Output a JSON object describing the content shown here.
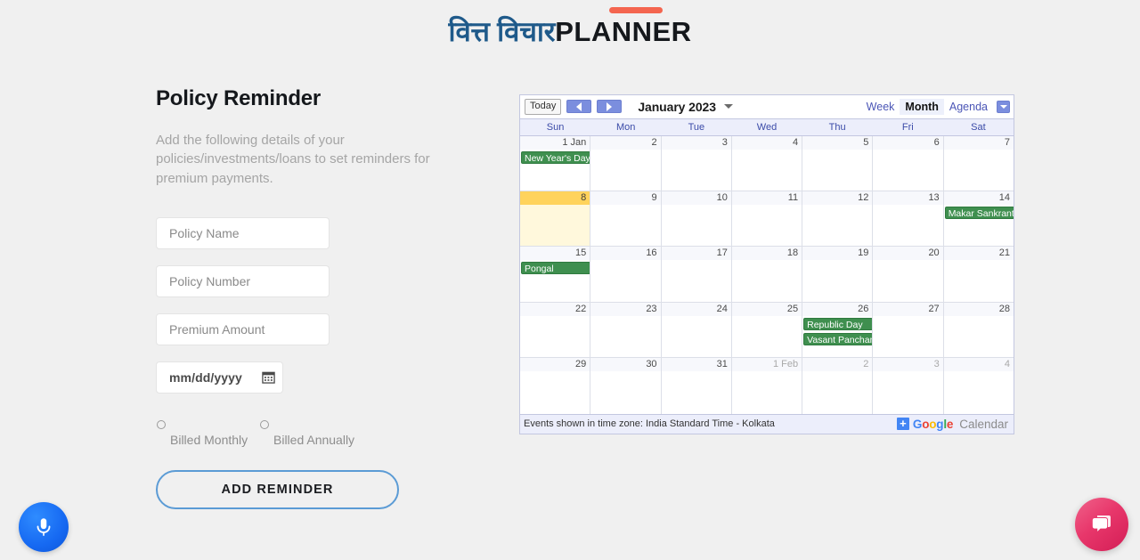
{
  "logo": {
    "hindi": "वित्त विचार",
    "english": "PLANNER",
    "bar_color": "#f4654f",
    "hindi_color": "#1f5a8a"
  },
  "form": {
    "title": "Policy Reminder",
    "description": "Add the following details of your policies/investments/loans to set reminders for premium payments.",
    "fields": [
      {
        "name": "policy-name",
        "placeholder": "Policy Name",
        "value": ""
      },
      {
        "name": "policy-number",
        "placeholder": "Policy Number",
        "value": ""
      },
      {
        "name": "premium-amount",
        "placeholder": "Premium Amount",
        "value": ""
      }
    ],
    "date": {
      "placeholder": "mm/dd/yyyy",
      "value": "mm/dd/yyyy",
      "icon": "calendar-icon"
    },
    "radios": [
      {
        "label": "Billed Monthly",
        "selected": false
      },
      {
        "label": "Billed Annually",
        "selected": false
      }
    ],
    "submit_label": "ADD REMINDER",
    "submit_border_color": "#5b9bd5"
  },
  "calendar": {
    "today_label": "Today",
    "prev_icon": "chevron-left-icon",
    "next_icon": "chevron-right-icon",
    "title": "January 2023",
    "title_caret_icon": "chevron-down-icon",
    "views": [
      {
        "label": "Week",
        "active": false
      },
      {
        "label": "Month",
        "active": true
      },
      {
        "label": "Agenda",
        "active": false
      }
    ],
    "view_caret_icon": "chevron-down-icon",
    "day_headers": [
      "Sun",
      "Mon",
      "Tue",
      "Wed",
      "Thu",
      "Fri",
      "Sat"
    ],
    "weeks": [
      [
        {
          "num": "1 Jan",
          "other": false,
          "today": false,
          "events": [
            {
              "title": "New Year's Day"
            }
          ]
        },
        {
          "num": "2",
          "other": false,
          "today": false,
          "events": []
        },
        {
          "num": "3",
          "other": false,
          "today": false,
          "events": []
        },
        {
          "num": "4",
          "other": false,
          "today": false,
          "events": []
        },
        {
          "num": "5",
          "other": false,
          "today": false,
          "events": []
        },
        {
          "num": "6",
          "other": false,
          "today": false,
          "events": []
        },
        {
          "num": "7",
          "other": false,
          "today": false,
          "events": []
        }
      ],
      [
        {
          "num": "8",
          "other": false,
          "today": true,
          "events": []
        },
        {
          "num": "9",
          "other": false,
          "today": false,
          "events": []
        },
        {
          "num": "10",
          "other": false,
          "today": false,
          "events": []
        },
        {
          "num": "11",
          "other": false,
          "today": false,
          "events": []
        },
        {
          "num": "12",
          "other": false,
          "today": false,
          "events": []
        },
        {
          "num": "13",
          "other": false,
          "today": false,
          "events": []
        },
        {
          "num": "14",
          "other": false,
          "today": false,
          "events": [
            {
              "title": "Makar Sankranti"
            }
          ]
        }
      ],
      [
        {
          "num": "15",
          "other": false,
          "today": false,
          "events": [
            {
              "title": "Pongal"
            }
          ]
        },
        {
          "num": "16",
          "other": false,
          "today": false,
          "events": []
        },
        {
          "num": "17",
          "other": false,
          "today": false,
          "events": []
        },
        {
          "num": "18",
          "other": false,
          "today": false,
          "events": []
        },
        {
          "num": "19",
          "other": false,
          "today": false,
          "events": []
        },
        {
          "num": "20",
          "other": false,
          "today": false,
          "events": []
        },
        {
          "num": "21",
          "other": false,
          "today": false,
          "events": []
        }
      ],
      [
        {
          "num": "22",
          "other": false,
          "today": false,
          "events": []
        },
        {
          "num": "23",
          "other": false,
          "today": false,
          "events": []
        },
        {
          "num": "24",
          "other": false,
          "today": false,
          "events": []
        },
        {
          "num": "25",
          "other": false,
          "today": false,
          "events": []
        },
        {
          "num": "26",
          "other": false,
          "today": false,
          "events": [
            {
              "title": "Republic Day"
            },
            {
              "title": "Vasant Panchami"
            }
          ]
        },
        {
          "num": "27",
          "other": false,
          "today": false,
          "events": []
        },
        {
          "num": "28",
          "other": false,
          "today": false,
          "events": []
        }
      ],
      [
        {
          "num": "29",
          "other": false,
          "today": false,
          "events": []
        },
        {
          "num": "30",
          "other": false,
          "today": false,
          "events": []
        },
        {
          "num": "31",
          "other": false,
          "today": false,
          "events": []
        },
        {
          "num": "1 Feb",
          "other": true,
          "today": false,
          "events": []
        },
        {
          "num": "2",
          "other": true,
          "today": false,
          "events": []
        },
        {
          "num": "3",
          "other": true,
          "today": false,
          "events": []
        },
        {
          "num": "4",
          "other": true,
          "today": false,
          "events": []
        }
      ]
    ],
    "timezone_text": "Events shown in time zone: India Standard Time - Kolkata",
    "brand": {
      "plus": "+",
      "google_letters": [
        "G",
        "o",
        "o",
        "g",
        "l",
        "e"
      ],
      "calendar_word": "Calendar"
    },
    "event_color": "#3f8f4f",
    "today_color": "#ffd35c"
  },
  "fabs": {
    "mic": {
      "icon": "microphone-icon",
      "color": "#1669f2"
    },
    "chat": {
      "icon": "chat-bubble-icon",
      "color": "#e8376b"
    }
  }
}
